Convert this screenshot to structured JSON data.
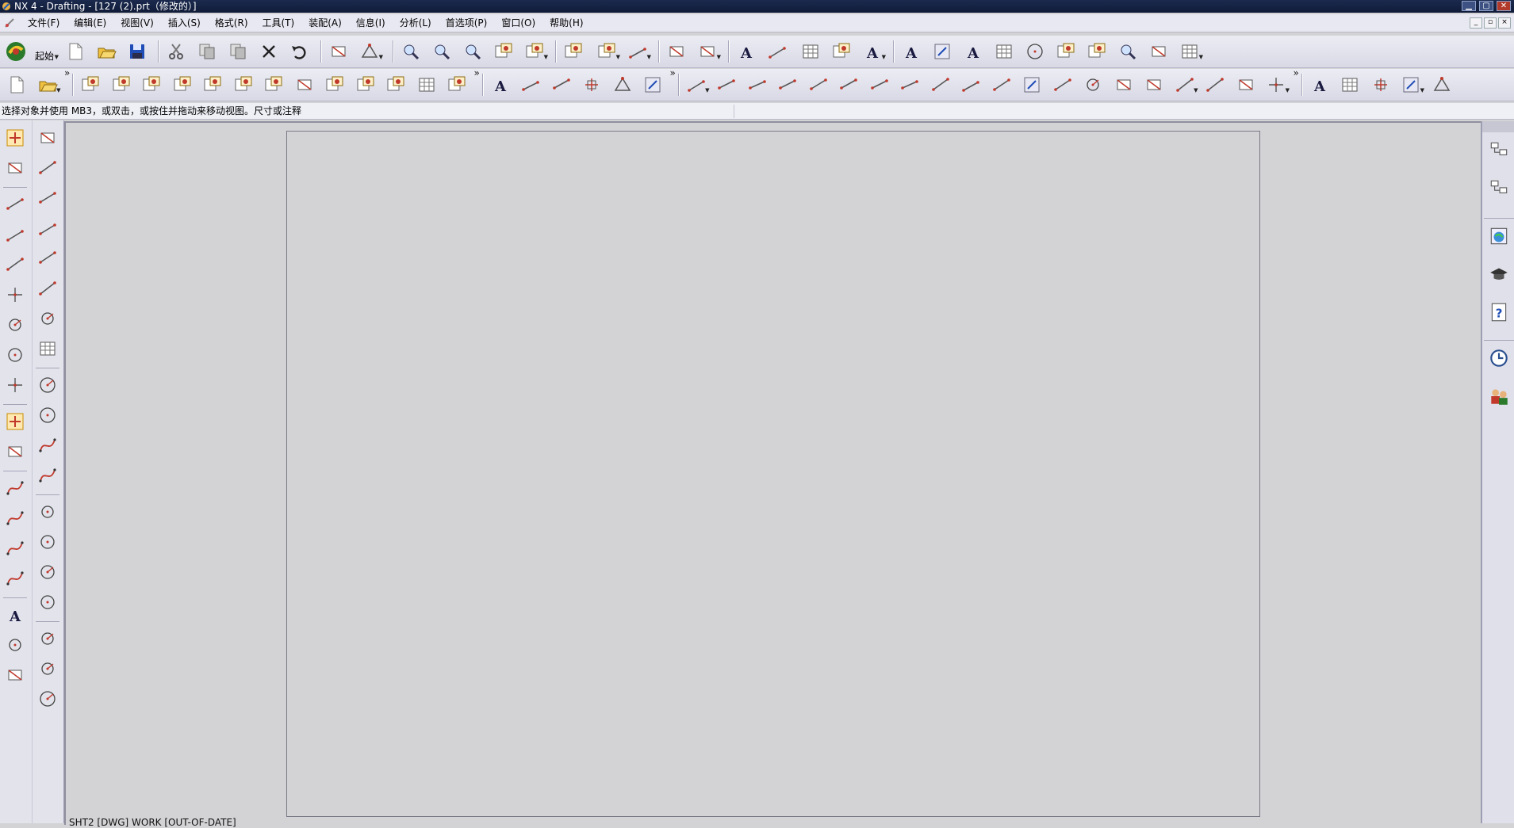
{
  "window": {
    "title": "NX 4 - Drafting - [127 (2).prt（修改的）]",
    "controls": [
      "▁",
      "▢",
      "✕"
    ]
  },
  "menu": {
    "items": [
      "文件(F)",
      "编辑(E)",
      "视图(V)",
      "插入(S)",
      "格式(R)",
      "工具(T)",
      "装配(A)",
      "信息(I)",
      "分析(L)",
      "首选项(P)",
      "窗口(O)",
      "帮助(H)"
    ],
    "mdi_controls": [
      "_",
      "▫",
      "×"
    ]
  },
  "toolbar": {
    "start_label": "起始",
    "more_glyph": "»"
  },
  "prompt": {
    "text": "选择对象并使用 MB3，或双击，或按住并拖动来移动视图。尺寸或注释"
  },
  "graphics": {
    "status_label": "SHT2 [DWG] WORK [OUT-OF-DATE]"
  },
  "icons": {
    "toolbar1": [
      "nx-start-icon",
      "new-icon",
      "open-icon",
      "save-icon",
      "cut-icon",
      "copy-icon",
      "paste-icon",
      "delete-icon",
      "undo-icon",
      "information-icon",
      "fit-icon",
      "zoom-window-icon",
      "zoom-icon",
      "zoom-in-icon",
      "layout-icon",
      "update-views-icon",
      "view-display-icon",
      "section-icon",
      "draft-line-icon",
      "ruler-icon",
      "symbol-icon",
      "text-icon",
      "dimension-icon",
      "grid-icon",
      "display-sheet-icon",
      "annotation-text-icon",
      "edit-text-icon",
      "id-symbol-icon",
      "note-icon",
      "table-icon",
      "search-icon",
      "view-icon",
      "view2-icon",
      "query-icon",
      "edit-icon",
      "hatch-icon"
    ],
    "toolbar2": [
      "new-sheet-icon",
      "open-sheet-icon",
      "base-view-icon",
      "projected-view-icon",
      "detail-view-icon",
      "section-view-icon",
      "revolved-view-icon",
      "half-section-icon",
      "unfolded-section-icon",
      "break-out-icon",
      "view-boundary-icon",
      "update-view-icon",
      "align-view-icon",
      "table-grid-icon",
      "move-view-icon",
      "annotation-icon",
      "dimension-line-icon",
      "centerline-icon",
      "leader-icon",
      "balloon-icon",
      "feature-frame-icon",
      "inferred-dim-icon",
      "horizontal-dim-icon",
      "angular-dim-icon",
      "vertical-dim-icon",
      "parallel-dim-icon",
      "perpendicular-dim-icon",
      "chamfer-dim-icon",
      "cylindrical-dim-icon",
      "hole-dim-icon",
      "diameter-dim-icon",
      "radius-dim-icon",
      "foreshortened-icon",
      "thickness-dim-icon",
      "arc-length-icon",
      "horizontal-chain-icon",
      "vertical-chain-icon",
      "horizontal-baseline-icon",
      "vertical-baseline-icon",
      "ordinate-icon",
      "crosshair-icon",
      "tabular-note-icon",
      "parts-list-icon",
      "auto-balloon-icon",
      "edit-style-icon",
      "pencil-icon"
    ],
    "left_col1": [
      "select-icon",
      "snap-icon",
      "line-icon",
      "line2-icon",
      "spline-icon",
      "point-icon",
      "circle-point-icon",
      "circle-icon",
      "cross-icon",
      "object-select-icon",
      "edit-object-icon",
      "trim-icon",
      "offset-icon",
      "curve-icon",
      "fillet-icon",
      "note-view-icon",
      "arc-icon",
      "chamfer-icon"
    ],
    "left_col2": [
      "lasso-icon",
      "line-tool-icon",
      "angle-line-icon",
      "parallel-line-icon",
      "perp-line-icon",
      "tangent-line-icon",
      "circle-tool-icon",
      "sketch-grid-icon",
      "arc-tool-icon",
      "arc2-icon",
      "offset-tool-icon",
      "extend-icon",
      "circle-center-icon",
      "circle-3pt-icon",
      "circle-radius-icon",
      "circle-tangent-icon",
      "point-circle-icon",
      "circle-dia-icon",
      "circle-arc-icon"
    ],
    "resource": [
      "assembly-navigator-icon",
      "part-navigator-icon",
      "web-browser-icon",
      "training-icon",
      "help-icon",
      "history-icon",
      "roles-icon"
    ]
  },
  "colors": {
    "title_bar": "#13224a",
    "background": "#d3d3d6",
    "icon_red": "#c0392b",
    "icon_blue": "#1f4db5"
  }
}
